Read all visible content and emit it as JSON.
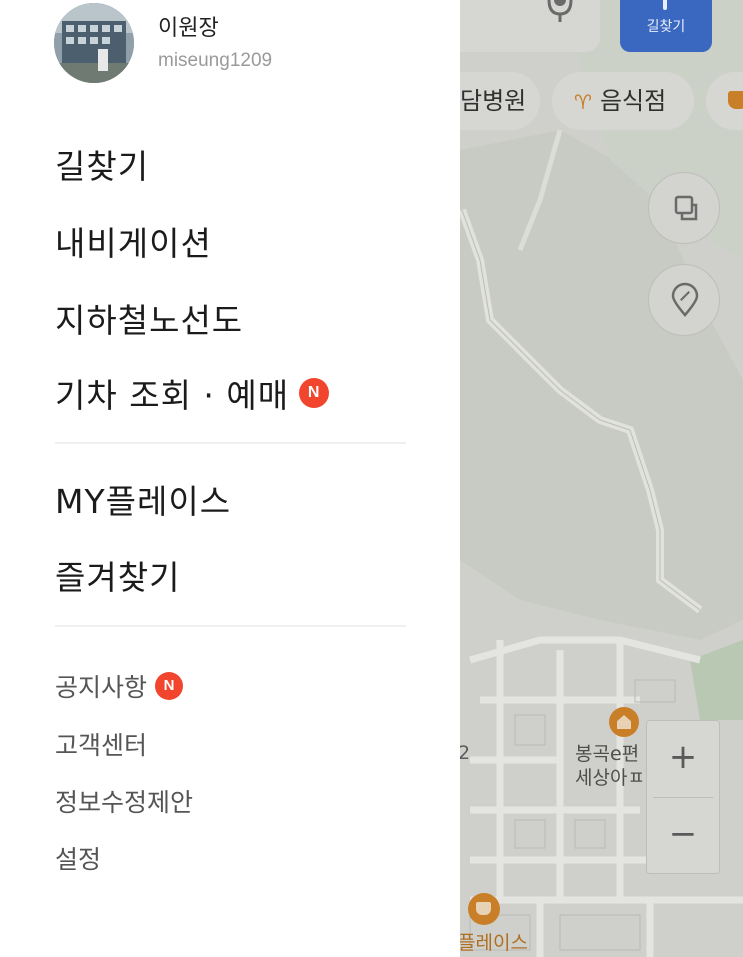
{
  "map": {
    "route_button_label": "길찾기",
    "chips": {
      "hospital": "담병원",
      "restaurant": "음식점"
    },
    "apartment_label_line1": "봉곡e편",
    "apartment_label_line2": "세상아ㅍ",
    "number_label": "2",
    "place_label": "플레이스",
    "zoom_in": "+",
    "zoom_out": "−",
    "colors": {
      "route_button": "#3a68c0",
      "poi_accent": "#c97f28"
    }
  },
  "drawer": {
    "profile": {
      "name": "이원장",
      "user_id": "miseung1209"
    },
    "primary_menu": [
      {
        "label": "길찾기"
      },
      {
        "label": "내비게이션"
      },
      {
        "label": "지하철노선도"
      },
      {
        "label": "기차 조회 · 예매",
        "badge": "N"
      }
    ],
    "secondary_menu": [
      {
        "label": "MY플레이스"
      },
      {
        "label": "즐겨찾기"
      }
    ],
    "tertiary_menu": [
      {
        "label": "공지사항",
        "badge": "N"
      },
      {
        "label": "고객센터"
      },
      {
        "label": "정보수정제안"
      },
      {
        "label": "설정"
      }
    ],
    "badge_color": "#f2452e"
  }
}
